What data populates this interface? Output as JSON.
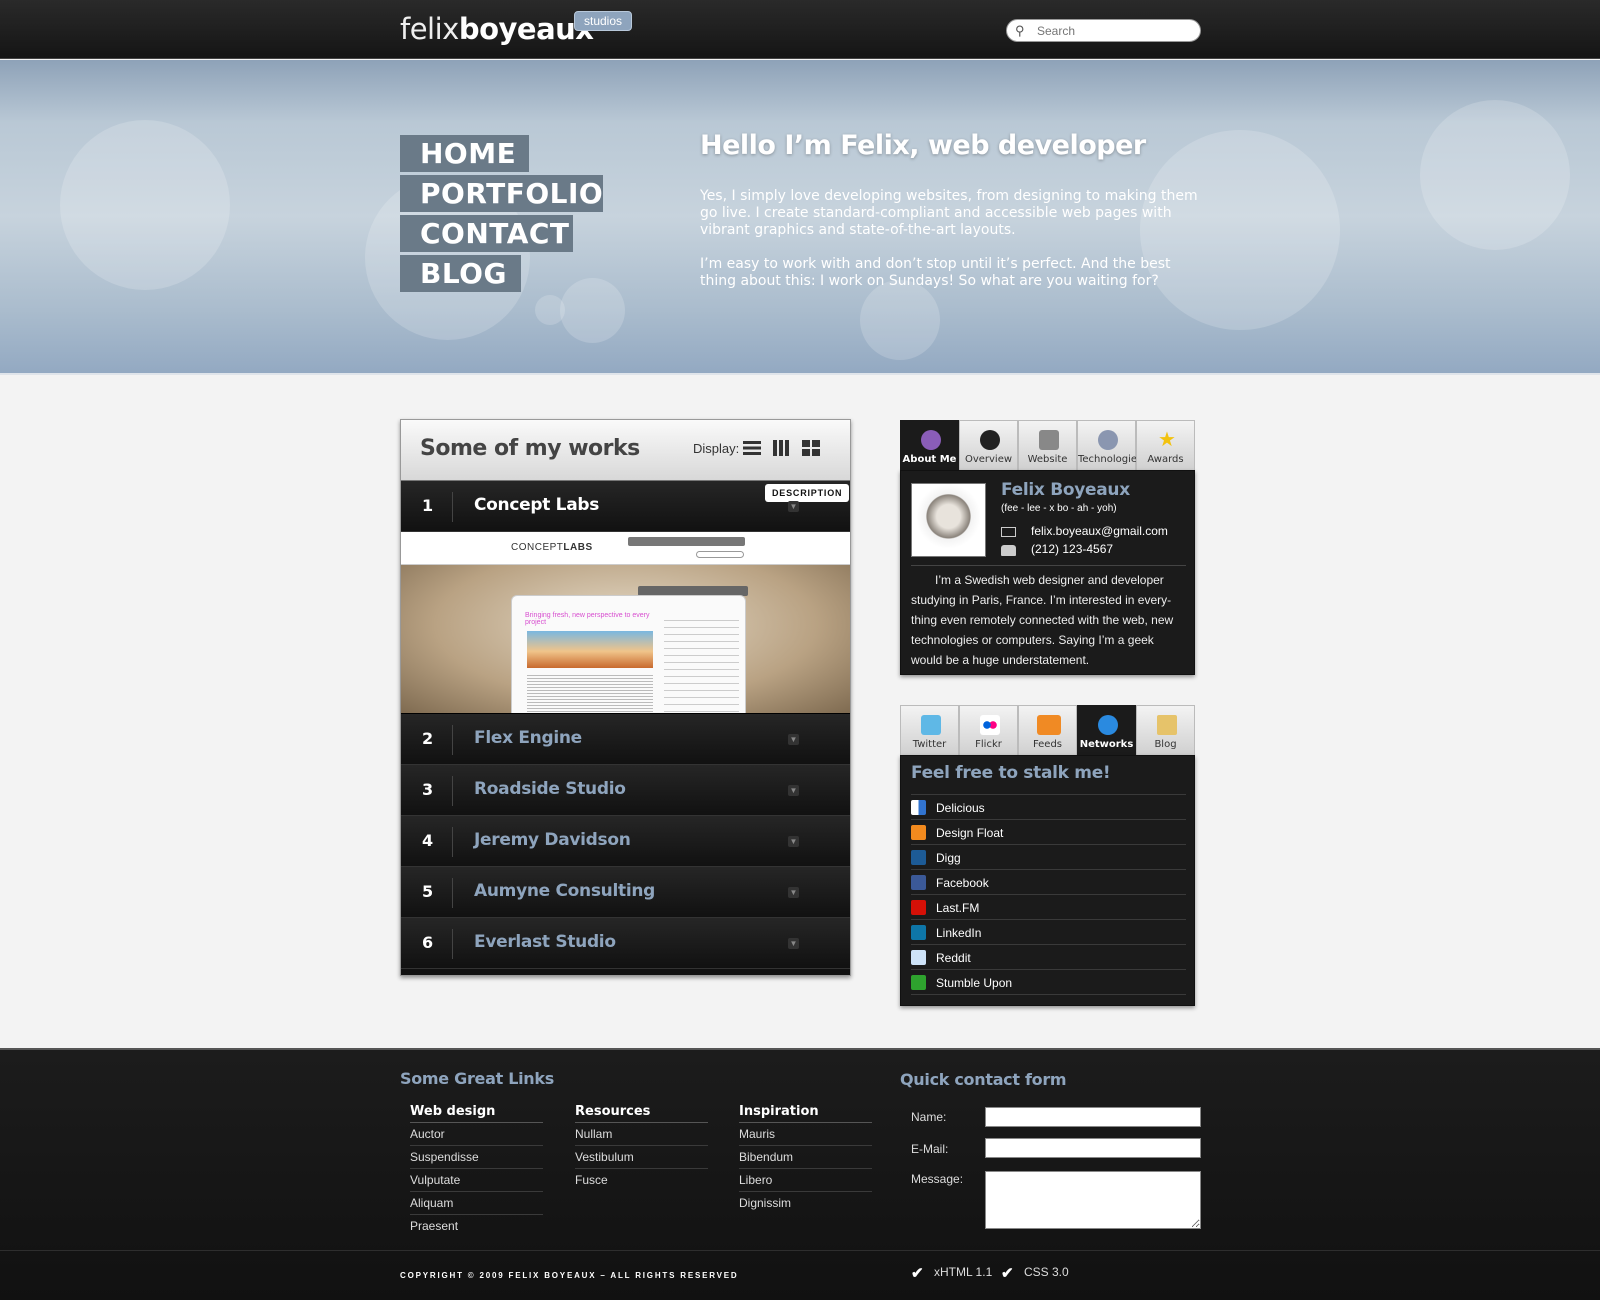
{
  "header": {
    "logo_light": "felix",
    "logo_bold": "boyeaux",
    "badge": "studios",
    "search_placeholder": "Search"
  },
  "nav": [
    {
      "label": "HOME"
    },
    {
      "label": "PORTFOLIO"
    },
    {
      "label": "CONTACT"
    },
    {
      "label": "BLOG"
    }
  ],
  "hero": {
    "title": "Hello I’m Felix, web developer",
    "para1": "Yes, I simply love developing websites, from designing to making them go live. I create standard-compliant and accessible web pages with vibrant graphics and state-of-the-art layouts.",
    "para2": "I’m easy to work with and don’t stop until it’s perfect. And the best thing about this: I work on Sundays! So what are you waiting for?"
  },
  "works": {
    "title": "Some of my works",
    "display_label": "Display:",
    "description_badge": "DESCRIPTION",
    "items": [
      {
        "num": "1",
        "name": "Concept Labs"
      },
      {
        "num": "2",
        "name": "Flex Engine"
      },
      {
        "num": "3",
        "name": "Roadside Studio"
      },
      {
        "num": "4",
        "name": "Jeremy Davidson"
      },
      {
        "num": "5",
        "name": "Aumyne Consulting"
      },
      {
        "num": "6",
        "name": "Everlast Studio"
      }
    ],
    "preview": {
      "logo_light": "CONCEPT",
      "logo_bold": "LABS",
      "headline": "Bringing fresh, new perspective to every project"
    }
  },
  "about_tabs": [
    {
      "label": "About Me",
      "icon": "about-icon",
      "color": "#8a5db8"
    },
    {
      "label": "Overview",
      "icon": "user-icon",
      "color": "#222222"
    },
    {
      "label": "Website",
      "icon": "server-icon",
      "color": "#888888"
    },
    {
      "label": "Technologies",
      "icon": "gear-icon",
      "color": "#8a96b0"
    },
    {
      "label": "Awards",
      "icon": "star-icon",
      "color": "#f2c20f"
    }
  ],
  "about": {
    "name": "Felix Boyeaux",
    "pronunciation": "(fee - lee - x   bo - ah - yoh)",
    "email": "felix.boyeaux@gmail.com",
    "phone": "(212) 123-4567",
    "bio": "I’m a Swedish web designer and developer studying in Paris, France. I’m interested in every-thing even remotely connected with the web, new technologies or computers. Saying I’m a geek would be a huge understatement."
  },
  "network_tabs": [
    {
      "label": "Twitter",
      "icon": "twitter-icon",
      "color": "#5fb8e6"
    },
    {
      "label": "Flickr",
      "icon": "flickr-icon",
      "color": "#ff0084"
    },
    {
      "label": "Feeds",
      "icon": "rss-icon",
      "color": "#f08a24"
    },
    {
      "label": "Networks",
      "icon": "globe-icon",
      "color": "#2a8ae0"
    },
    {
      "label": "Blog",
      "icon": "pencil-icon",
      "color": "#e6c36a"
    }
  ],
  "networks": {
    "title": "Feel free to stalk me!",
    "items": [
      {
        "label": "Delicious",
        "icon": "delicious-icon",
        "color": "#3274d0"
      },
      {
        "label": "Design Float",
        "icon": "designfloat-icon",
        "color": "#f28a1e"
      },
      {
        "label": "Digg",
        "icon": "digg-icon",
        "color": "#1d5b96"
      },
      {
        "label": "Facebook",
        "icon": "facebook-icon",
        "color": "#3b5998"
      },
      {
        "label": "Last.FM",
        "icon": "lastfm-icon",
        "color": "#d51007"
      },
      {
        "label": "LinkedIn",
        "icon": "linkedin-icon",
        "color": "#0e76a8"
      },
      {
        "label": "Reddit",
        "icon": "reddit-icon",
        "color": "#cee3f8"
      },
      {
        "label": "Stumble Upon",
        "icon": "stumbleupon-icon",
        "color": "#2ea32e"
      }
    ]
  },
  "footer": {
    "links_title": "Some Great Links",
    "columns": [
      {
        "title": "Web design",
        "links": [
          "Auctor",
          "Suspendisse",
          "Vulputate",
          "Aliquam",
          "Praesent"
        ]
      },
      {
        "title": "Resources",
        "links": [
          "Nullam",
          "Vestibulum",
          "Fusce"
        ]
      },
      {
        "title": "Inspiration",
        "links": [
          "Mauris",
          "Bibendum",
          "Libero",
          "Dignissim"
        ]
      }
    ],
    "contact_title": "Quick contact form",
    "name_label": "Name:",
    "email_label": "E-Mail:",
    "message_label": "Message:",
    "copyright": "COPYRIGHT © 2009 FELIX BOYEAUX – ALL RIGHTS RESERVED",
    "valid_xhtml": "xHTML 1.1",
    "valid_css": "CSS 3.0"
  }
}
